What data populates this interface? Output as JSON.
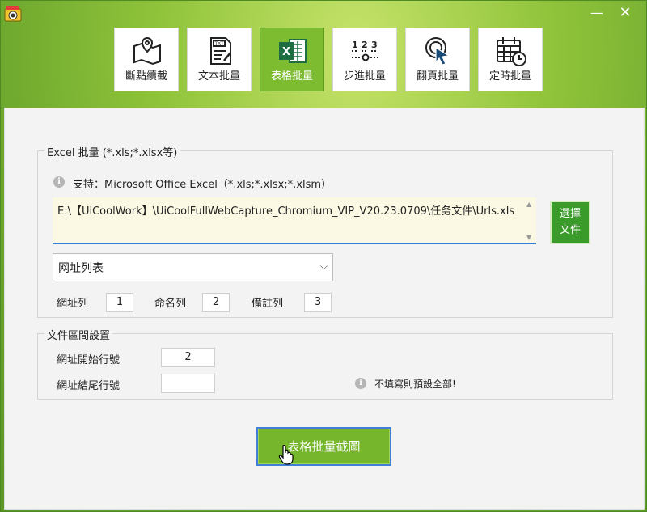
{
  "window": {
    "minimize": "—",
    "close": "✕"
  },
  "toolbar": {
    "items": [
      {
        "label": "斷點續截",
        "icon": "map-pin-icon"
      },
      {
        "label": "文本批量",
        "icon": "txt-file-icon"
      },
      {
        "label": "表格批量",
        "icon": "excel-icon",
        "active": true
      },
      {
        "label": "步進批量",
        "icon": "step-numbers-icon"
      },
      {
        "label": "翻頁批量",
        "icon": "click-cursor-icon"
      },
      {
        "label": "定時批量",
        "icon": "calendar-clock-icon"
      }
    ]
  },
  "excel": {
    "legend": "Excel 批量 (*.xls;*.xlsx等)",
    "support_text": "支持：Microsoft Office Excel（*.xls;*.xlsx;*.xlsm）",
    "path_value": "E:\\【UiCoolWork】\\UiCoolFullWebCapture_Chromium_VIP_V20.23.0709\\任务文件\\Urls.xls",
    "choose_button": {
      "line1": "選擇",
      "line2": "文件"
    },
    "sheet_select": "网址列表",
    "url_col_label": "網址列",
    "url_col_value": "1",
    "name_col_label": "命名列",
    "name_col_value": "2",
    "remark_col_label": "備註列",
    "remark_col_value": "3"
  },
  "range": {
    "legend": "文件區間設置",
    "start_label": "網址開始行號",
    "start_value": "2",
    "end_label": "網址結尾行號",
    "end_value": "",
    "hint": "不填寫則預設全部!"
  },
  "action": {
    "label": "表格批量截圖"
  },
  "colors": {
    "accent": "#7dbb31",
    "focus": "#3a7bd5",
    "choose": "#3a9a2a"
  }
}
